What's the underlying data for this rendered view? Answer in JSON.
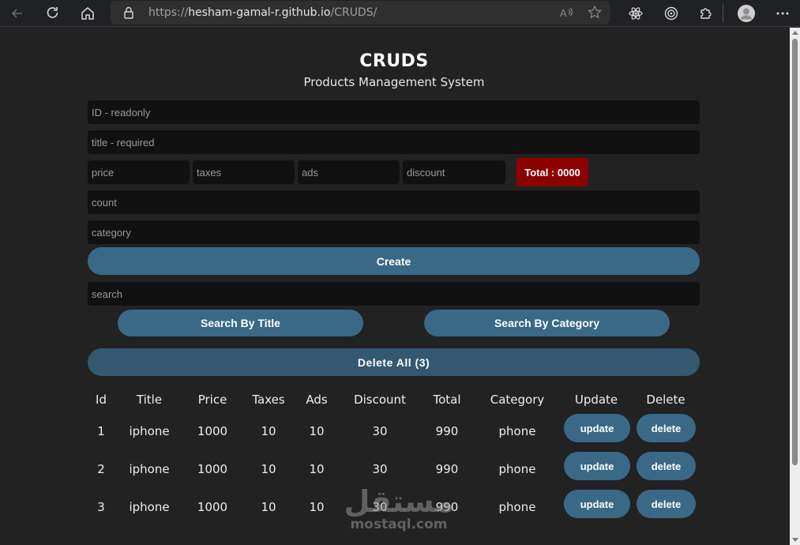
{
  "browser": {
    "url_prefix": "https://",
    "url_host": "hesham-gamal-r.github.io",
    "url_path": "/CRUDS/"
  },
  "header": {
    "title": "CRUDS",
    "subtitle": "Products Management System"
  },
  "form": {
    "id_placeholder": "ID - readonly",
    "title_placeholder": "title - required",
    "price_placeholder": "price",
    "taxes_placeholder": "taxes",
    "ads_placeholder": "ads",
    "discount_placeholder": "discount",
    "total_label": "Total : 0000",
    "count_placeholder": "count",
    "category_placeholder": "category",
    "create_label": "Create"
  },
  "search": {
    "placeholder": "search",
    "by_title_label": "Search By Title",
    "by_category_label": "Search By Category"
  },
  "delete_all_label": "Delete All (3)",
  "table": {
    "headers": [
      "Id",
      "Title",
      "Price",
      "Taxes",
      "Ads",
      "Discount",
      "Total",
      "Category",
      "Update",
      "Delete"
    ],
    "rows": [
      {
        "id": "1",
        "title": "iphone",
        "price": "1000",
        "taxes": "10",
        "ads": "10",
        "discount": "30",
        "total": "990",
        "category": "phone",
        "update": "update",
        "delete": "delete"
      },
      {
        "id": "2",
        "title": "iphone",
        "price": "1000",
        "taxes": "10",
        "ads": "10",
        "discount": "30",
        "total": "990",
        "category": "phone",
        "update": "update",
        "delete": "delete"
      },
      {
        "id": "3",
        "title": "iphone",
        "price": "1000",
        "taxes": "10",
        "ads": "10",
        "discount": "30",
        "total": "990",
        "category": "phone",
        "update": "update",
        "delete": "delete"
      }
    ]
  },
  "watermark": {
    "arabic": "مستقل",
    "latin": "mostaql.com"
  },
  "colors": {
    "background": "#222222",
    "input": "#111111",
    "accent": "#3a6887",
    "total": "#8b0000"
  }
}
